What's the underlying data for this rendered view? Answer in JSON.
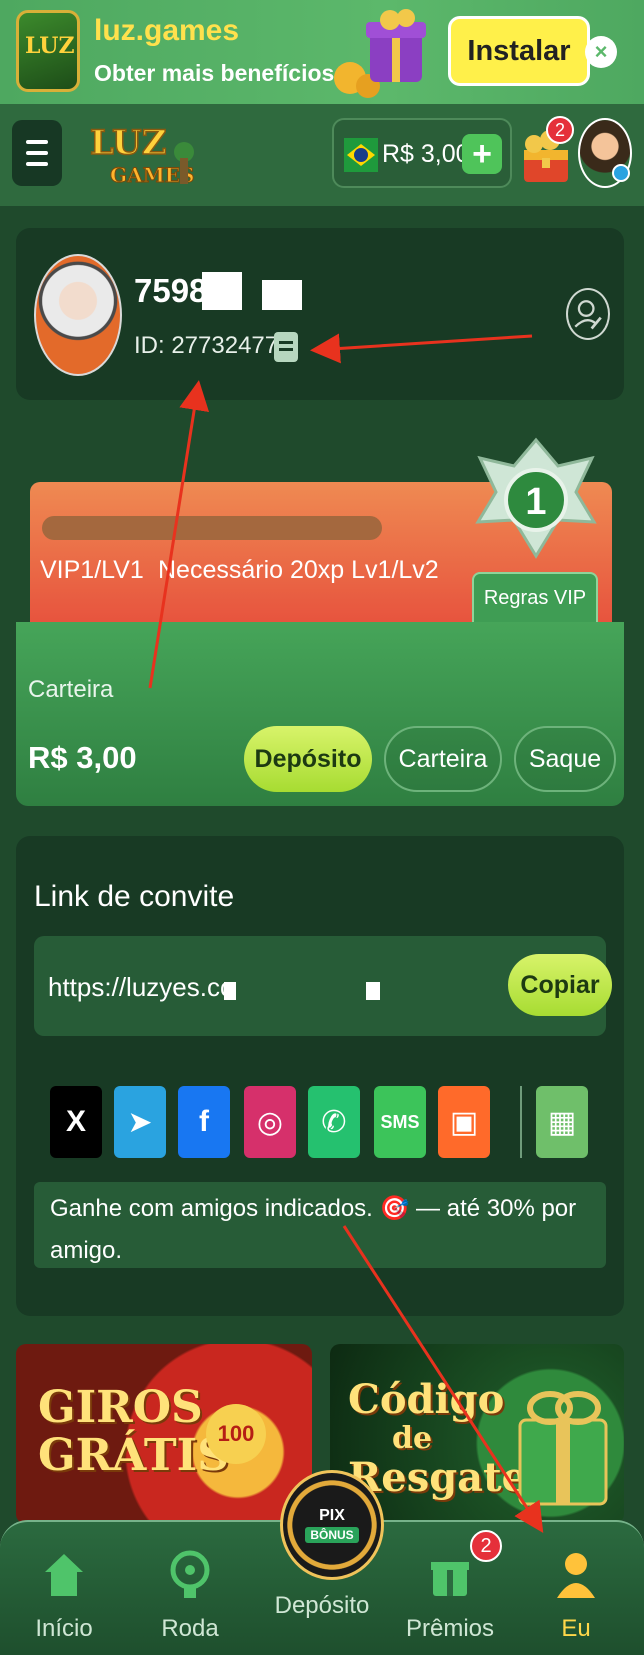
{
  "banner": {
    "title": "luz.games",
    "subtitle": "Obter mais benefícios",
    "install_label": "Instalar",
    "close_label": "×",
    "logo_text": "LUZ"
  },
  "header": {
    "balance": "R$ 3,00",
    "plus_label": "+",
    "rewards_badge": "2",
    "logo_line1": "LUZ",
    "logo_line2": "GAMES"
  },
  "profile": {
    "name": "75988",
    "id_text": "ID: 27732477"
  },
  "vip": {
    "level": "VIP1/LV1",
    "requirement": "Necessário 20xp Lv1/Lv2",
    "badge_number": "1",
    "rules_label": "Regras VIP",
    "progress": 0
  },
  "wallet": {
    "label": "Carteira",
    "amount": "R$ 3,00",
    "deposit_label": "Depósito",
    "wallet_label": "Carteira",
    "withdraw_label": "Saque"
  },
  "invite": {
    "title": "Link de convite",
    "link": "https://luzyes.co",
    "copy_label": "Copiar",
    "share": [
      {
        "name": "x-icon",
        "glyph": "X",
        "bg": "#000000"
      },
      {
        "name": "telegram-icon",
        "glyph": "➤",
        "bg": "#2aa3e0"
      },
      {
        "name": "facebook-icon",
        "glyph": "f",
        "bg": "#1877f2"
      },
      {
        "name": "instagram-icon",
        "glyph": "◎",
        "bg": "#d6306b"
      },
      {
        "name": "whatsapp-icon",
        "glyph": "✆",
        "bg": "#25c16f"
      },
      {
        "name": "sms-icon",
        "glyph": "SMS",
        "bg": "#3cc45a"
      },
      {
        "name": "kwai-icon",
        "glyph": "▣",
        "bg": "#ff6a2a"
      },
      {
        "name": "more-apps-icon",
        "glyph": "▦",
        "bg": "#6fbf6a"
      }
    ],
    "note": "Ganhe com amigos indicados. 🎯 — até 30% por amigo."
  },
  "promos": {
    "left_line1": "GIROS",
    "left_line2": "GRÁTIS",
    "wheel_center": "100",
    "right_line1": "Código",
    "right_line2": "de",
    "right_line3": "Resgate"
  },
  "nav": {
    "home": "Início",
    "wheel": "Roda",
    "deposit": "Depósito",
    "prizes": "Prêmios",
    "me": "Eu",
    "prizes_badge": "2",
    "center_pix": "PIX",
    "center_bonus": "BÔNUS"
  },
  "colors": {
    "accent_active": "#ffd84a",
    "deposit_green": "#a7dc32",
    "annotation_red": "#e8321e"
  }
}
